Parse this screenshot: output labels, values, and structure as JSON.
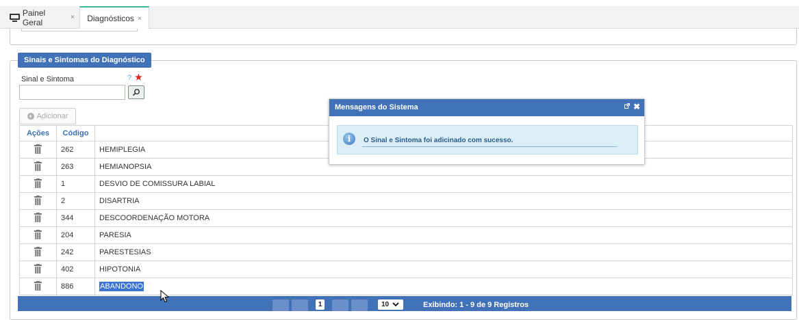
{
  "tabs": [
    {
      "label": "Painel Geral",
      "icon": "monitor-icon",
      "active": false
    },
    {
      "label": "Diagnósticos",
      "active": true
    }
  ],
  "tab_close_glyph": "×",
  "section": {
    "title": "Sinais e Sintomas do Diagnóstico"
  },
  "form": {
    "field_label": "Sinal e Sintoma",
    "help_glyph": "?",
    "required_glyph": "★",
    "value": "",
    "add_label": "Adicionar"
  },
  "table": {
    "headers": [
      "Ações",
      "Código",
      ""
    ],
    "rows": [
      {
        "code": "262",
        "name": "HEMIPLEGIA"
      },
      {
        "code": "263",
        "name": "HEMIANOPSIA"
      },
      {
        "code": "1",
        "name": "DESVIO DE COMISSURA LABIAL"
      },
      {
        "code": "2",
        "name": "DISARTRIA"
      },
      {
        "code": "344",
        "name": "DESCOORDENAÇÃO MOTORA"
      },
      {
        "code": "204",
        "name": "PARESIA"
      },
      {
        "code": "242",
        "name": "PARESTESIAS"
      },
      {
        "code": "402",
        "name": "HIPOTONIA"
      },
      {
        "code": "886",
        "name": "ABANDONO",
        "selected": true
      }
    ]
  },
  "pager": {
    "current_page": "1",
    "page_size": "10",
    "info": "Exibindo: 1 - 9 de 9 Registros"
  },
  "dialog": {
    "title": "Mensagens do Sistema",
    "message": "O Sinal e Sintoma foi adicinado com sucesso."
  },
  "colors": {
    "header_blue": "#4171b7",
    "tab_accent": "#3fb5a4",
    "info_bg": "#dbeef6",
    "selection": "#3b73d1"
  }
}
